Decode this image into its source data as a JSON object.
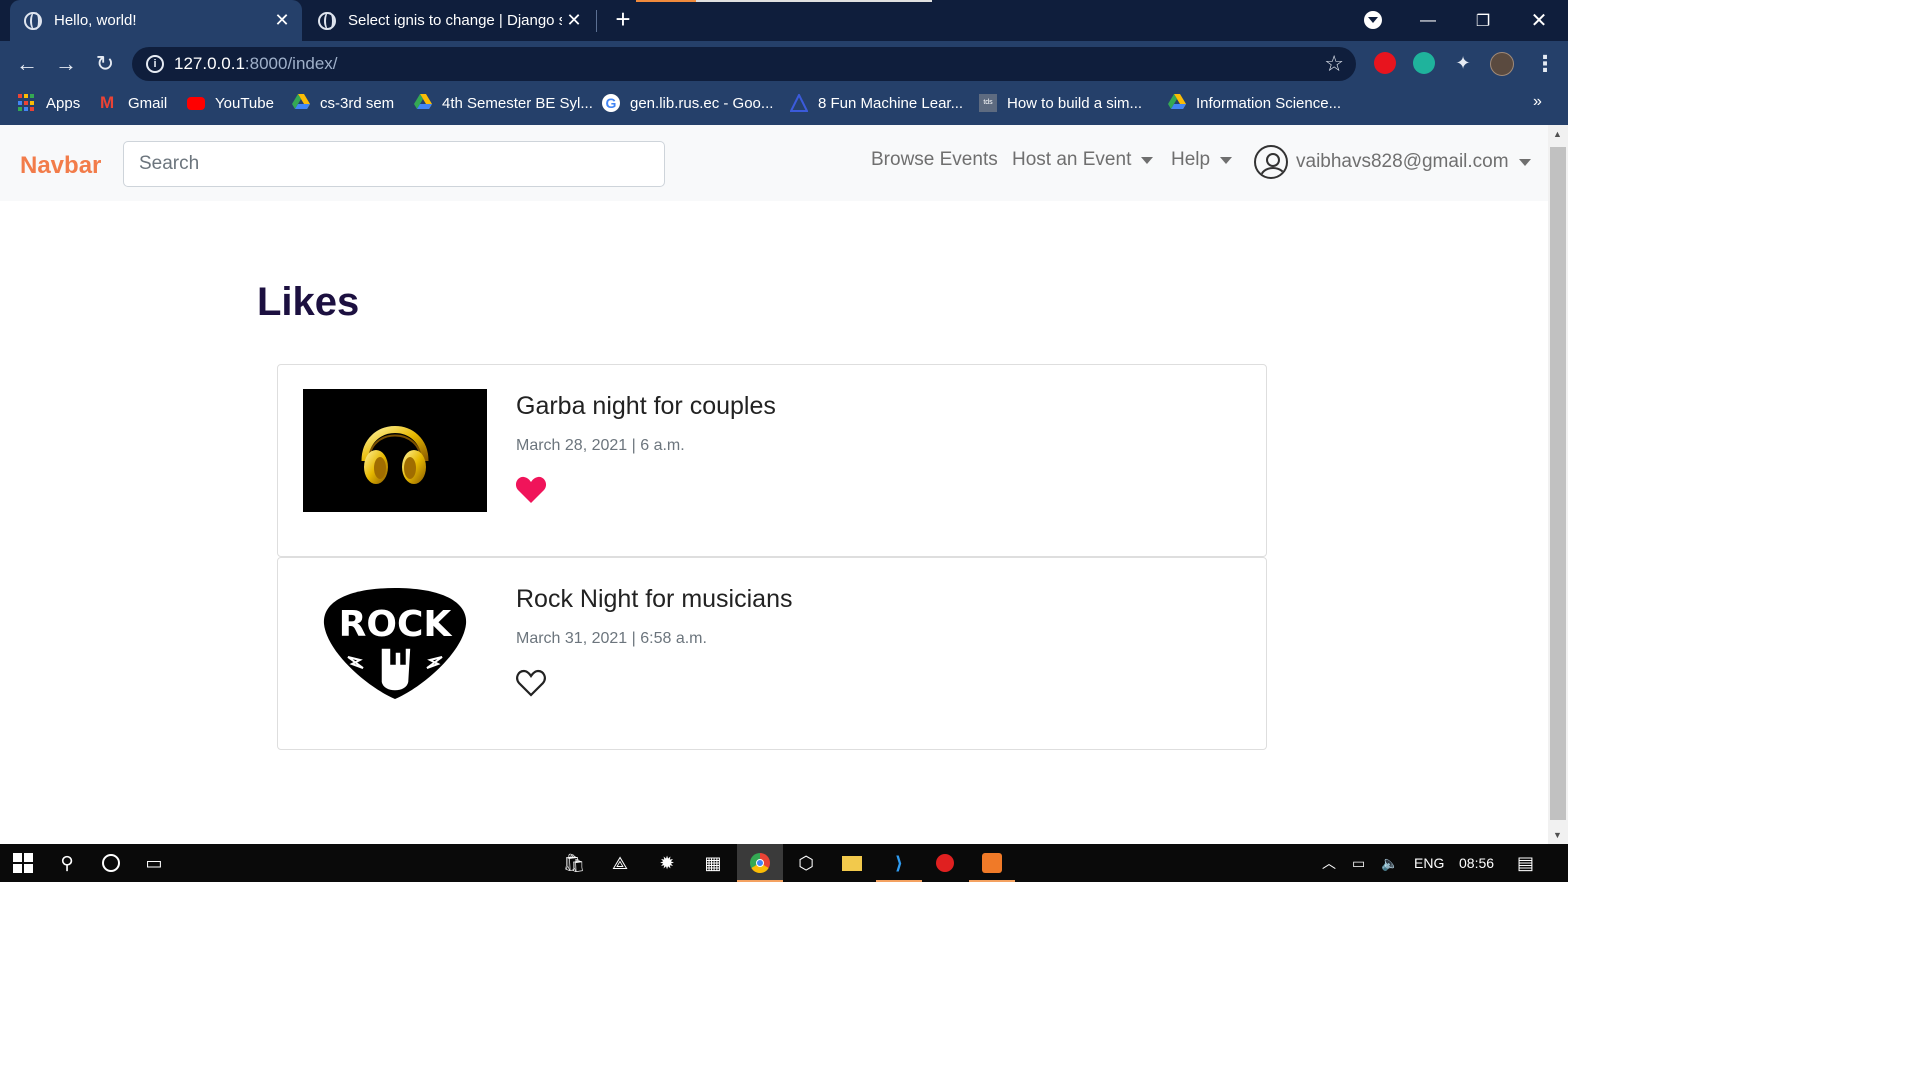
{
  "browser": {
    "tabs": [
      {
        "title": "Hello, world!",
        "active": true
      },
      {
        "title": "Select ignis to change | Django si",
        "active": false
      }
    ],
    "address": {
      "host": "127.0.0.1",
      "path": ":8000/index/"
    },
    "bookmarks": [
      "Apps",
      "Gmail",
      "YouTube",
      "cs-3rd sem",
      "4th Semester BE Syl...",
      "gen.lib.rus.ec - Goo...",
      "8 Fun Machine Lear...",
      "How to build a sim...",
      "Information Science..."
    ],
    "more_bookmarks": "»"
  },
  "navbar": {
    "brand": "Navbar",
    "search_placeholder": "Search",
    "links": [
      "Browse Events",
      "Host an Event",
      "Help"
    ],
    "user_email": "vaibhavs828@gmail.com"
  },
  "main": {
    "heading": "Likes",
    "events": [
      {
        "title": "Garba night for couples",
        "date": "March 28, 2021 | 6 a.m.",
        "liked": true,
        "thumbnail": "headphones"
      },
      {
        "title": "Rock Night for musicians",
        "date": "March 31, 2021 | 6:58 a.m.",
        "liked": false,
        "thumbnail": "rock-badge",
        "thumbnail_text": "ROCK"
      }
    ]
  },
  "taskbar": {
    "language": "ENG",
    "time": "08:56"
  },
  "colors": {
    "brand": "#f27c4a",
    "heading": "#1c1040",
    "heart": "#f0145a",
    "chrome_dark": "#0f1e3c",
    "chrome_light": "#25406a"
  }
}
